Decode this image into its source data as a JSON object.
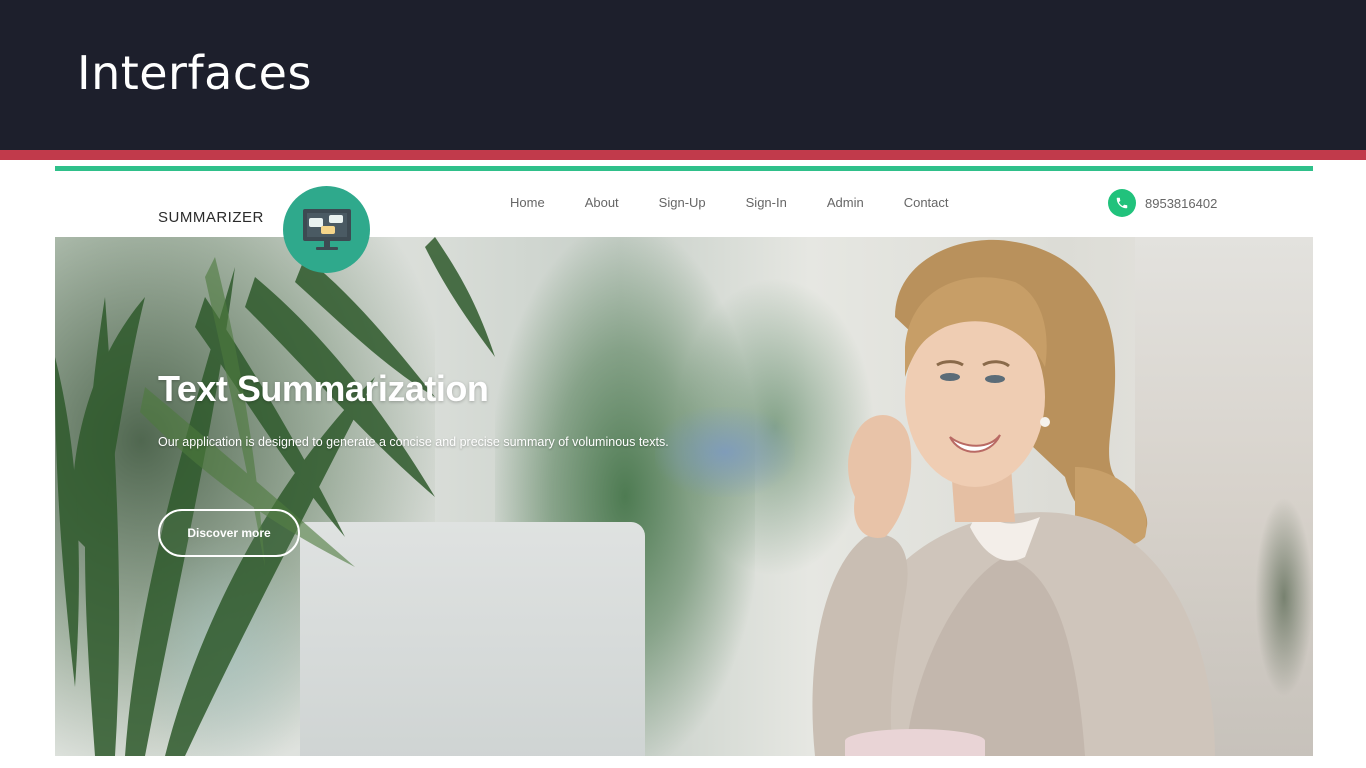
{
  "slide": {
    "title": "Interfaces"
  },
  "site": {
    "brand": "SUMMARIZER",
    "logo_icon": "chat-monitor-icon",
    "nav": [
      {
        "label": "Home"
      },
      {
        "label": "About"
      },
      {
        "label": "Sign-Up"
      },
      {
        "label": "Sign-In"
      },
      {
        "label": "Admin"
      },
      {
        "label": "Contact"
      }
    ],
    "phone": {
      "icon": "phone-icon",
      "number": "8953816402"
    },
    "hero": {
      "title": "Text Summarization",
      "description": "Our application is designed to generate a concise and precise summary of voluminous texts.",
      "button_label": "Discover more"
    }
  },
  "colors": {
    "slide_header_bg": "#1d1f2c",
    "slide_accent": "#c13a4b",
    "site_accent_green": "#2fc08a",
    "logo_teal": "#2fa98c",
    "phone_green": "#21c27c"
  }
}
